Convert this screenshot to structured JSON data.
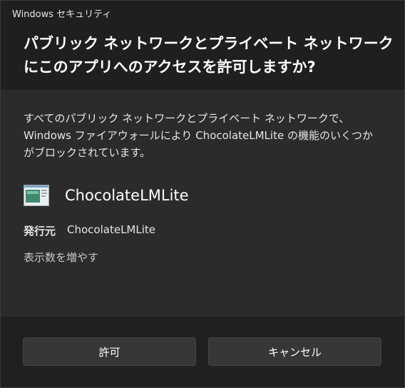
{
  "window": {
    "title": "Windows セキュリティ"
  },
  "dialog": {
    "heading": "パブリック ネットワークとプライベート ネットワークにこのアプリへのアクセスを許可しますか?",
    "description": "すべてのパブリック ネットワークとプライベート ネットワークで、Windows ファイアウォールにより ChocolateLMLite の機能のいくつかがブロックされています。",
    "app_name": "ChocolateLMLite",
    "publisher_label": "発行元",
    "publisher_value": "ChocolateLMLite",
    "more_link": "表示数を増やす"
  },
  "buttons": {
    "allow": "許可",
    "cancel": "キャンセル"
  },
  "icons": {
    "app": "app-window-icon"
  },
  "colors": {
    "header_bg": "#1f1f1f",
    "content_bg": "#2b2b2b",
    "footer_bg": "#202020",
    "button_bg": "#373737"
  }
}
